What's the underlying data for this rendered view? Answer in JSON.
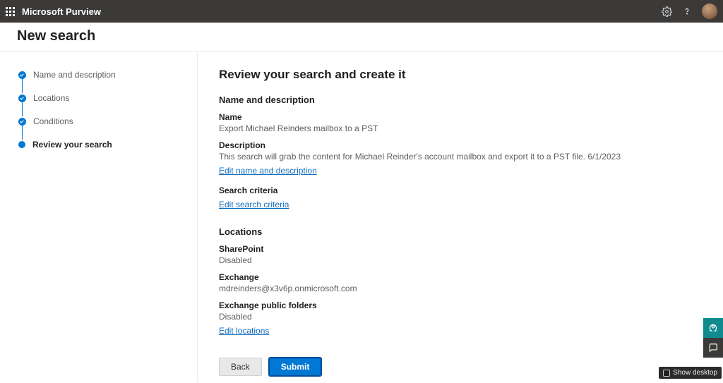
{
  "header": {
    "app_title": "Microsoft Purview",
    "page_title": "New search"
  },
  "wizard_steps": [
    {
      "label": "Name and description",
      "state": "done"
    },
    {
      "label": "Locations",
      "state": "done"
    },
    {
      "label": "Conditions",
      "state": "done"
    },
    {
      "label": "Review your search",
      "state": "current"
    }
  ],
  "review": {
    "heading": "Review your search and create it",
    "sections": {
      "name_desc": {
        "title": "Name and description",
        "name_label": "Name",
        "name_value": "Export Michael Reinders mailbox to a PST",
        "desc_label": "Description",
        "desc_value": "This search will grab the content for Michael Reinder's account mailbox and export it to a PST file. 6/1/2023",
        "edit_label": "Edit name and description"
      },
      "criteria": {
        "title": "Search criteria",
        "edit_label": "Edit search criteria"
      },
      "locations": {
        "title": "Locations",
        "sharepoint_label": "SharePoint",
        "sharepoint_value": "Disabled",
        "exchange_label": "Exchange",
        "exchange_value": "mdreinders@x3v6p.onmicrosoft.com",
        "public_folders_label": "Exchange public folders",
        "public_folders_value": "Disabled",
        "edit_label": "Edit locations"
      }
    }
  },
  "footer": {
    "back_label": "Back",
    "submit_label": "Submit"
  },
  "misc": {
    "show_desktop": "Show desktop"
  }
}
